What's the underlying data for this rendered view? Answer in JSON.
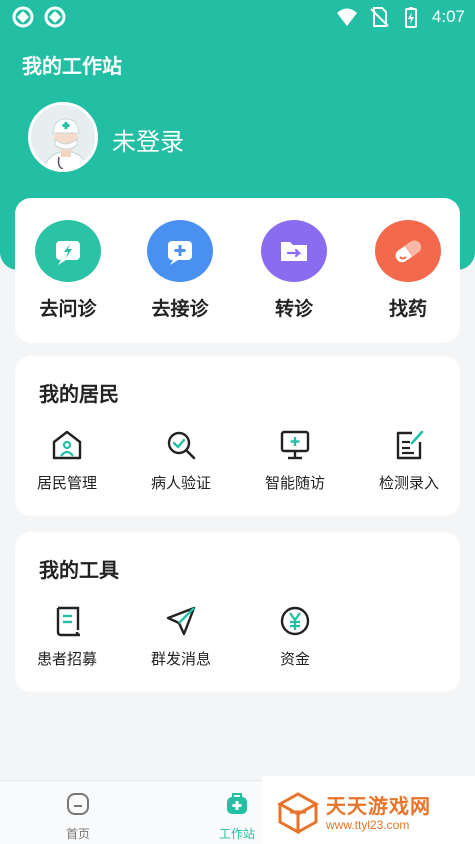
{
  "status_bar": {
    "time": "4:07"
  },
  "header": {
    "title": "我的工作站",
    "user_name": "未登录"
  },
  "quick_actions": [
    {
      "label": "去问诊",
      "icon": "lightning-chat-icon",
      "color": "#2bc3a6"
    },
    {
      "label": "去接诊",
      "icon": "plus-chat-icon",
      "color": "#4a90f0"
    },
    {
      "label": "转诊",
      "icon": "folder-transfer-icon",
      "color": "#8a6cf0"
    },
    {
      "label": "找药",
      "icon": "pill-icon",
      "color": "#f26a4b"
    }
  ],
  "residents": {
    "title": "我的居民",
    "items": [
      {
        "label": "居民管理",
        "icon": "house-person-icon"
      },
      {
        "label": "病人验证",
        "icon": "search-check-icon"
      },
      {
        "label": "智能随访",
        "icon": "monitor-plus-icon"
      },
      {
        "label": "检测录入",
        "icon": "edit-document-icon"
      }
    ]
  },
  "tools": {
    "title": "我的工具",
    "items": [
      {
        "label": "患者招募",
        "icon": "scroll-document-icon"
      },
      {
        "label": "群发消息",
        "icon": "send-icon"
      },
      {
        "label": "资金",
        "icon": "yen-coin-icon"
      }
    ]
  },
  "bottom_nav": [
    {
      "label": "首页",
      "icon": "home-icon",
      "active": false
    },
    {
      "label": "工作站",
      "icon": "medical-bag-icon",
      "active": true
    }
  ],
  "watermark": {
    "title": "天天游戏网",
    "url": "www.ttyl23.com"
  },
  "colors": {
    "primary": "#22bfa4",
    "watermark": "#e8742a"
  }
}
